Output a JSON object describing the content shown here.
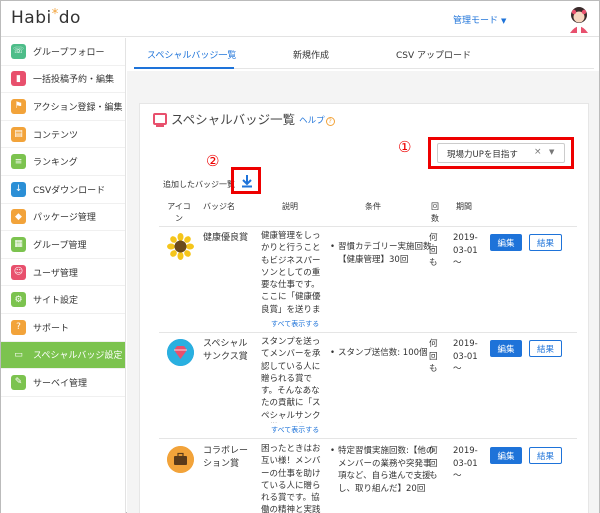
{
  "header": {
    "logo_left": "Habi",
    "logo_star": "*",
    "logo_right": "do",
    "admin_mode": "管理モード",
    "accent": "#1e73d9"
  },
  "sidebar": {
    "items": [
      {
        "label": "グループフォロー",
        "icon": "group-follow-icon",
        "color": "#4dbd89"
      },
      {
        "label": "一括投稿予約・編集",
        "icon": "bulk-post-icon",
        "color": "#e8506d"
      },
      {
        "label": "アクション登録・編集",
        "icon": "flag-icon",
        "color": "#f2a33a"
      },
      {
        "label": "コンテンツ",
        "icon": "document-icon",
        "color": "#f2a33a"
      },
      {
        "label": "ランキング",
        "icon": "ranking-icon",
        "color": "#7cc34f"
      },
      {
        "label": "CSVダウンロード",
        "icon": "download-icon",
        "color": "#2b8fd6"
      },
      {
        "label": "パッケージ管理",
        "icon": "package-icon",
        "color": "#f2a33a"
      },
      {
        "label": "グループ管理",
        "icon": "group-grid-icon",
        "color": "#7cc34f"
      },
      {
        "label": "ユーザ管理",
        "icon": "users-icon",
        "color": "#e8506d"
      },
      {
        "label": "サイト設定",
        "icon": "gear-icon",
        "color": "#7cc34f"
      },
      {
        "label": "サポート",
        "icon": "help-icon",
        "color": "#f2a33a"
      },
      {
        "label": "スペシャルバッジ設定",
        "icon": "monitor-icon",
        "color": "#7cc34f",
        "active": true
      },
      {
        "label": "サーベイ管理",
        "icon": "pen-icon",
        "color": "#7cc34f"
      }
    ]
  },
  "tabs": [
    {
      "label": "スペシャルバッジ一覧",
      "active": true
    },
    {
      "label": "新規作成"
    },
    {
      "label": "CSV アップロード"
    }
  ],
  "page": {
    "title": "スペシャルバッジ一覧",
    "help": "ヘルプ",
    "help_mark": "?",
    "annotation_1": "①",
    "annotation_2": "②",
    "filter_value": "現場力UPを目指す",
    "filter_clear": "×",
    "added_label": "追加したバッジ一覧",
    "show_all": "すべて表示する"
  },
  "table": {
    "headers": {
      "icon": "アイコン",
      "name": "バッジ名",
      "desc": "説明",
      "cond": "条件",
      "count": "回数",
      "period": "期間"
    },
    "edit_label": "編集",
    "result_label": "結果",
    "rows": [
      {
        "name": "健康優良賞",
        "icon": "sunflower-icon",
        "desc": "健康管理をしっかりと行うこともビジネスパーソンとしての重要な仕事です。ここに「健康優良賞」を送ります。",
        "cond": "習慣カテゴリー実施回数:【健康管理】30回",
        "count": "何回も",
        "period": "2019-03-01 〜"
      },
      {
        "name": "スペシャルサンクス賞",
        "icon": "gem-icon",
        "desc": "スタンプを送ってメンバーを承認している人に贈られる賞です。そんなあなたの貢献に「スペシャルサンクス賞」を送ります。",
        "cond": "スタンプ送信数: 100個",
        "count": "何回も",
        "period": "2019-03-01 〜"
      },
      {
        "name": "コラボレーション賞",
        "icon": "briefcase-icon",
        "desc": "困ったときはお互い様！メンバーの仕事を助けている人に贈られる賞です。協働の精神と実践",
        "cond": "特定習慣実施回数:【他のメンバーの業務や突発事項など、自ら進んで支援し、取り組んだ】20回",
        "count": "何回も",
        "period": "2019-03-01 〜"
      }
    ]
  }
}
